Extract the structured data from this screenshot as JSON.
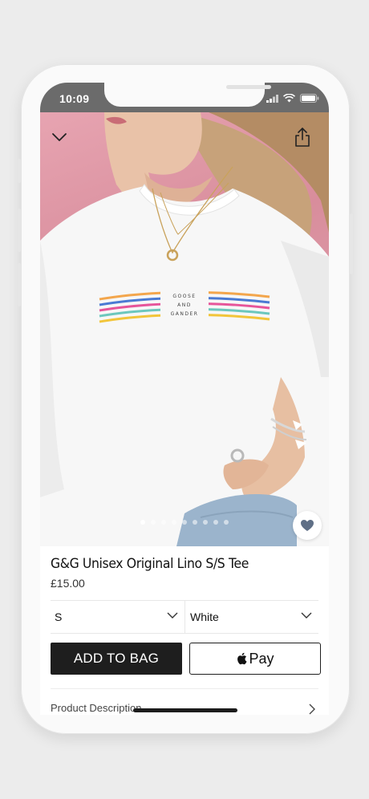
{
  "status_bar": {
    "time": "10:09"
  },
  "gallery": {
    "image_alt": "Model wearing white tee with rainbow stripe print",
    "print_text": [
      "GOOSE",
      "AND",
      "GANDER"
    ],
    "image_count": 9,
    "active_index": 0
  },
  "product": {
    "title": "G&G Unisex Original Lino S/S Tee",
    "price": "£15.00"
  },
  "options": {
    "size": "S",
    "colour": "White"
  },
  "actions": {
    "add_to_bag": "ADD TO BAG",
    "apple_pay": "Pay"
  },
  "sections": {
    "description": "Product Description"
  },
  "colors": {
    "button_dark": "#1e1e1e",
    "stripe_orange": "#f3a64c",
    "stripe_blue": "#4a7ad3",
    "stripe_pink": "#e6559a",
    "stripe_teal": "#6cc7bd",
    "stripe_yellow": "#f2c53a"
  },
  "icons": {
    "close": "chevron-down-icon",
    "share": "share-icon",
    "favourite": "heart-icon",
    "apple": "apple-logo-icon"
  }
}
